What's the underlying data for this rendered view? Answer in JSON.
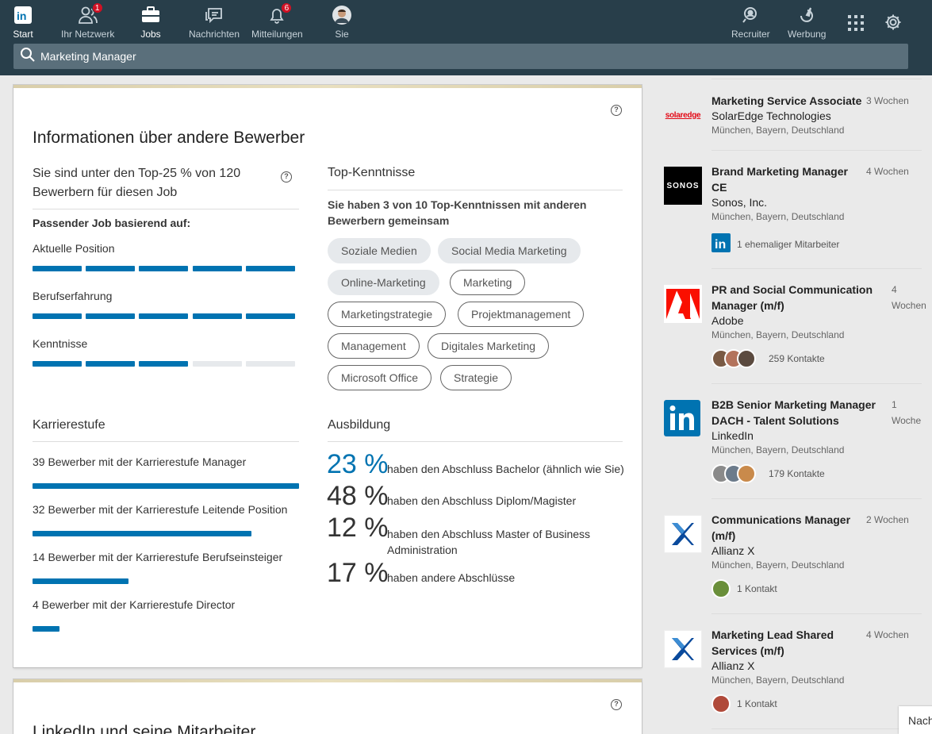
{
  "nav": {
    "items": [
      {
        "label": "Start",
        "badge": ""
      },
      {
        "label": "Ihr Netzwerk",
        "badge": "1"
      },
      {
        "label": "Jobs",
        "badge": ""
      },
      {
        "label": "Nachrichten",
        "badge": ""
      },
      {
        "label": "Mitteilungen",
        "badge": "6"
      },
      {
        "label": "Sie",
        "badge": ""
      }
    ],
    "right": [
      {
        "label": "Recruiter"
      },
      {
        "label": "Werbung"
      }
    ]
  },
  "search": {
    "value": "Marketing Manager"
  },
  "applicants": {
    "title": "Informationen über andere Bewerber",
    "rank_text": "Sie sind unter den Top-25 % von 120 Bewerbern für diesen Job",
    "matching_heading": "Passender Job basierend auf:",
    "matches": [
      {
        "label": "Aktuelle Position",
        "filled": 5,
        "total": 5
      },
      {
        "label": "Berufserfahrung",
        "filled": 5,
        "total": 5
      },
      {
        "label": "Kenntnisse",
        "filled": 3,
        "total": 5
      }
    ],
    "skills": {
      "heading": "Top-Kenntnisse",
      "summary": "Sie haben 3 von 10 Top-Kenntnissen mit anderen Bewerbern gemeinsam",
      "pills": [
        {
          "label": "Soziale Medien",
          "shared": true
        },
        {
          "label": "Social Media Marketing",
          "shared": true
        },
        {
          "label": "Online-Marketing",
          "shared": true
        },
        {
          "label": "Marketing",
          "shared": false
        },
        {
          "label": "Marketingstrategie",
          "shared": false
        },
        {
          "label": "Projektmanagement",
          "shared": false
        },
        {
          "label": "Management",
          "shared": false
        },
        {
          "label": "Digitales Marketing",
          "shared": false
        },
        {
          "label": "Microsoft Office",
          "shared": false
        },
        {
          "label": "Strategie",
          "shared": false
        }
      ]
    },
    "career": {
      "heading": "Karrierestufe",
      "rows": [
        {
          "label": "39 Bewerber mit der Karrierestufe Manager",
          "count": 39
        },
        {
          "label": "32 Bewerber mit der Karrierestufe Leitende Position",
          "count": 32
        },
        {
          "label": "14 Bewerber mit der Karrierestufe Berufseinsteiger",
          "count": 14
        },
        {
          "label": "4 Bewerber mit der Karrierestufe Director",
          "count": 4
        }
      ]
    },
    "education": {
      "heading": "Ausbildung",
      "rows": [
        {
          "pct": "23 %",
          "label": "haben den Abschluss Bachelor (ähnlich wie Sie)",
          "highlight": true
        },
        {
          "pct": "48 %",
          "label": "haben den Abschluss Diplom/Magister",
          "highlight": false
        },
        {
          "pct": "12 %",
          "label": "haben den Abschluss Master of Business Administration",
          "highlight": false
        },
        {
          "pct": "17 %",
          "label": "haben andere Abschlüsse",
          "highlight": false
        }
      ]
    }
  },
  "second_card": {
    "title": "LinkedIn und seine Mitarbeiter"
  },
  "jobs": [
    {
      "title": "Marketing Service Associate",
      "company": "SolarEdge Technologies",
      "location": "München, Bayern, Deutschland",
      "time": "3 Wochen",
      "meta": "",
      "logo": "solaredge"
    },
    {
      "title": "Brand Marketing Manager CE",
      "company": "Sonos, Inc.",
      "location": "München, Bayern, Deutschland",
      "time": "4 Wochen",
      "meta": "1 ehemaliger Mitarbeiter",
      "logo": "sonos"
    },
    {
      "title": "PR and Social Communication Manager (m/f)",
      "company": "Adobe",
      "location": "München, Bayern, Deutschland",
      "time": "4 Wochen",
      "meta": "259 Kontakte",
      "logo": "adobe"
    },
    {
      "title": "B2B Senior Marketing Manager DACH - Talent Solutions",
      "company": "LinkedIn",
      "location": "München, Bayern, Deutschland",
      "time": "1 Woche",
      "meta": "179 Kontakte",
      "logo": "linkedin"
    },
    {
      "title": "Communications Manager (m/f)",
      "company": "Allianz X",
      "location": "München, Bayern, Deutschland",
      "time": "2 Wochen",
      "meta": "1 Kontakt",
      "logo": "allianzx"
    },
    {
      "title": "Marketing Lead Shared Services (m/f)",
      "company": "Allianz X",
      "location": "München, Bayern, Deutschland",
      "time": "4 Wochen",
      "meta": "1 Kontakt",
      "logo": "allianzx"
    }
  ],
  "logos": {
    "solaredge": "solaredge",
    "sonos": "SONOS"
  },
  "side_tab": {
    "label": "Nach"
  },
  "colors": {
    "brand": "#0073b1",
    "nav_bg": "#283e4a",
    "badge": "#d11124"
  }
}
